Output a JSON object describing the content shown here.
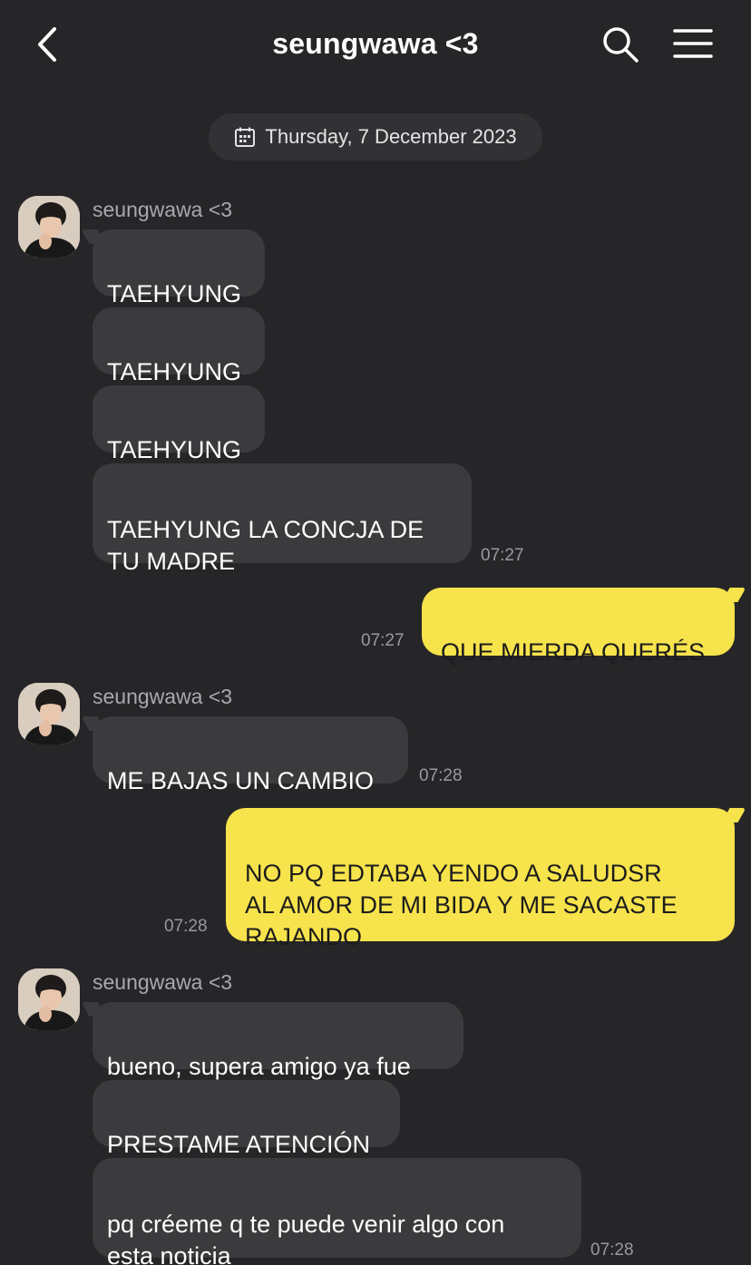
{
  "header": {
    "title": "seungwawa <3",
    "back_icon": "chevron-left-icon",
    "search_icon": "search-icon",
    "menu_icon": "hamburger-menu-icon"
  },
  "date_divider": {
    "label": "Thursday, 7 December 2023",
    "icon": "calendar-icon"
  },
  "colors": {
    "background": "#262628",
    "incoming_bubble": "#3b3b3e",
    "outgoing_bubble": "#f7e34c",
    "timestamp": "#9a9a9e"
  },
  "messages": {
    "group1": {
      "sender": "seungwawa <3",
      "m1": "TAEHYUNG",
      "m2": "TAEHYUNG",
      "m3": "TAEHYUNG",
      "m4": "TAEHYUNG LA CONCJA DE\nTU MADRE",
      "time": "07:27"
    },
    "out1": {
      "text": "QUE MIERDA QUERÉS",
      "time": "07:27"
    },
    "group2": {
      "sender": "seungwawa <3",
      "m1": "ME BAJAS UN CAMBIO",
      "time": "07:28"
    },
    "out2": {
      "text": "NO PQ EDTABA YENDO A SALUDSR\nAL AMOR DE MI BIDA Y ME SACASTE\nRAJANDO",
      "time": "07:28"
    },
    "group3": {
      "sender": "seungwawa <3",
      "m1": "bueno, supera amigo ya fue",
      "m2": "PRESTAME ATENCIÓN",
      "m3": "pq créeme q te puede venir algo con\nesta noticia",
      "time": "07:28"
    }
  }
}
